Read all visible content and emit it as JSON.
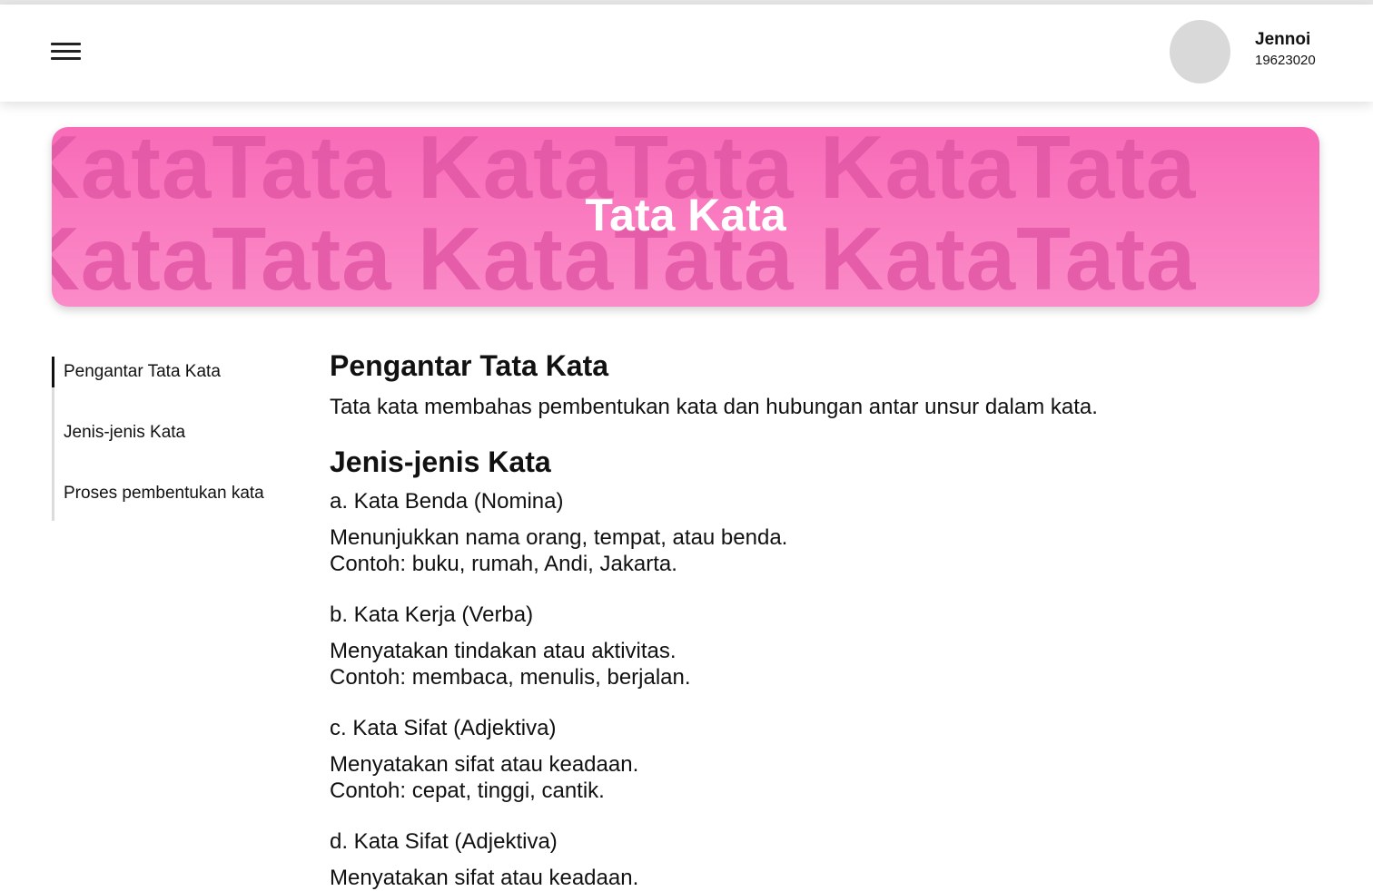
{
  "header": {
    "user_name": "Jennoi",
    "user_id": "19623020"
  },
  "banner": {
    "title": "Tata Kata",
    "watermark_row1": "KataTata KataTata KataTata",
    "watermark_row2": "KataTata KataTata KataTata"
  },
  "toc": {
    "items": [
      {
        "label": "Pengantar Tata Kata",
        "active": true
      },
      {
        "label": "Jenis-jenis Kata",
        "active": false
      },
      {
        "label": "Proses pembentukan kata",
        "active": false
      }
    ]
  },
  "content": {
    "intro_heading": "Pengantar Tata Kata",
    "intro_text": "Tata kata membahas pembentukan kata dan hubungan antar unsur dalam kata.",
    "jenis_heading": "Jenis-jenis Kata",
    "jenis": [
      {
        "title": "a. Kata Benda (Nomina)",
        "desc": "Menunjukkan nama orang, tempat, atau benda.",
        "example": "Contoh: buku, rumah, Andi, Jakarta."
      },
      {
        "title": "b. Kata Kerja (Verba)",
        "desc": "Menyatakan tindakan atau aktivitas.",
        "example": "Contoh: membaca, menulis, berjalan."
      },
      {
        "title": "c. Kata Sifat (Adjektiva)",
        "desc": "Menyatakan sifat atau keadaan.",
        "example": "Contoh: cepat, tinggi, cantik."
      },
      {
        "title": "d. Kata Sifat (Adjektiva)",
        "desc": "Menyatakan sifat atau keadaan.",
        "example": ""
      }
    ]
  },
  "colors": {
    "banner_top": "#f86bb7",
    "banner_bottom": "#fb8bc8",
    "watermark": "#e257a5",
    "avatar": "#d9d9d9"
  },
  "icons": {
    "menu": "hamburger-menu-icon"
  }
}
